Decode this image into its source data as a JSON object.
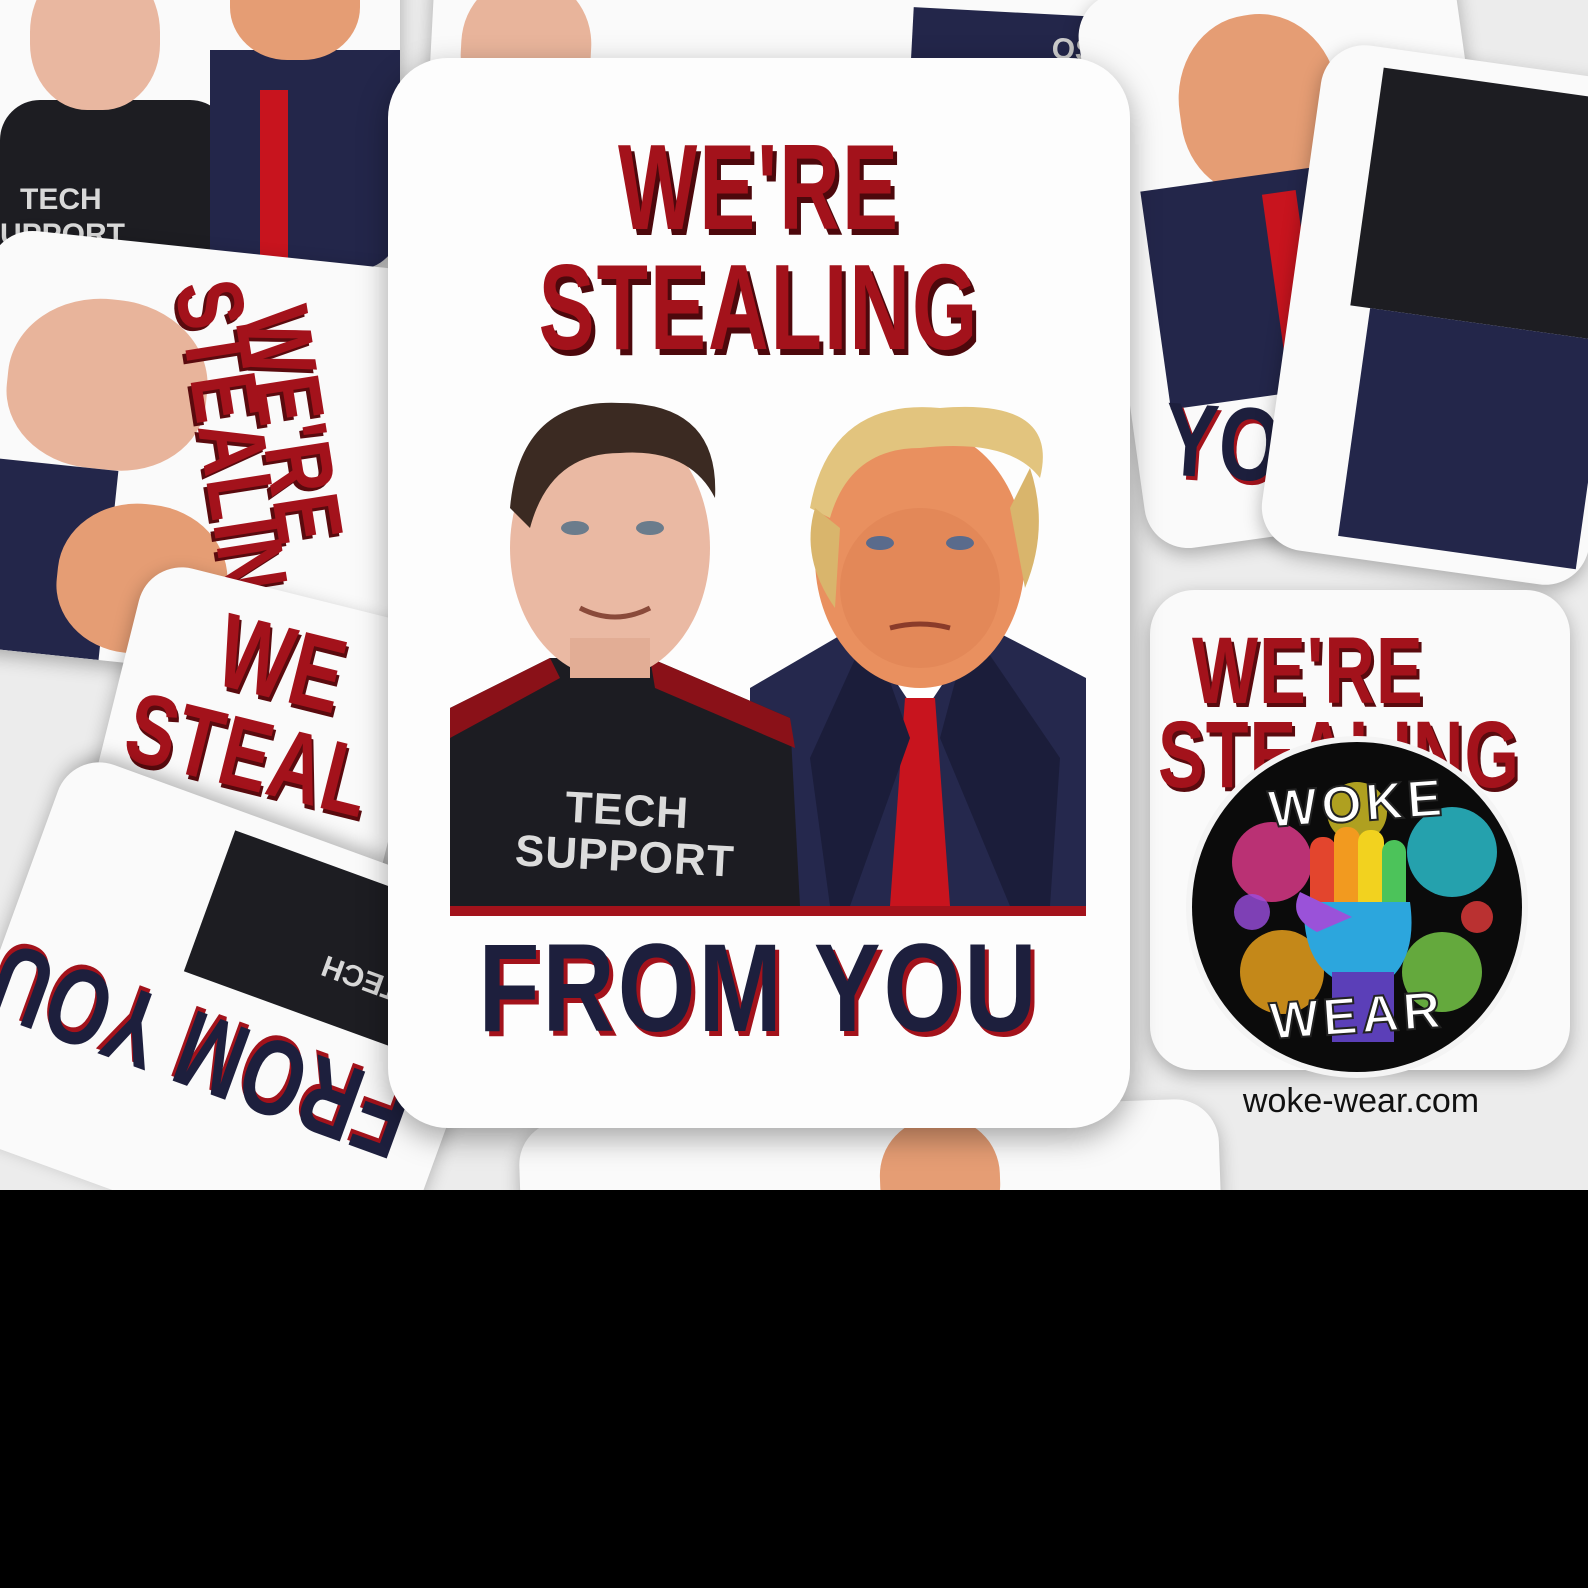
{
  "sticker": {
    "line1": "WE'RE",
    "line2": "STEALING",
    "line3": "FROM YOU",
    "shirt_text_1": "TECH",
    "shirt_text_2": "SUPPORT"
  },
  "background": {
    "fragment_we_re": "WE'RE",
    "fragment_stealing": "STEALING",
    "fragment_stealin": "STEALIN",
    "fragment_we": "WE",
    "fragment_steal": "STEAL",
    "fragment_from_you": "FROM YOU",
    "fragment_you": "YOU",
    "fragment_tech": "TECH",
    "fragment_support": "UPPORT",
    "fragment_os": "OS"
  },
  "logo": {
    "word_top": "WOKE",
    "word_bottom": "WEAR",
    "website": "woke-wear.com"
  },
  "colors": {
    "red": "#a3121b",
    "navy": "#1d1f3d",
    "background_bottom": "#000000"
  }
}
